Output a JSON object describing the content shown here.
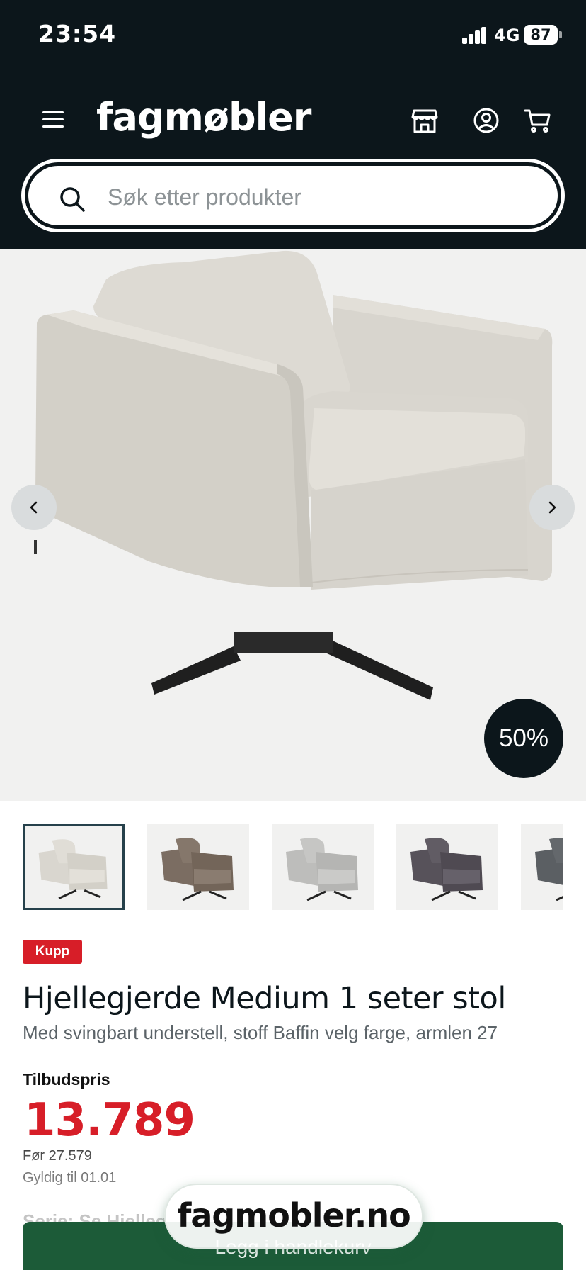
{
  "status_bar": {
    "time": "23:54",
    "network": "4G",
    "battery": "87"
  },
  "header": {
    "logo": "fagmøbler",
    "icons": [
      "menu-icon",
      "store-icon",
      "account-icon",
      "cart-icon"
    ]
  },
  "search": {
    "placeholder": "Søk etter produkter",
    "value": ""
  },
  "gallery": {
    "discount_badge": "50%",
    "thumbnail_colors": [
      "#d9d6cf",
      "#7b6d62",
      "#bdbdbb",
      "#57525a",
      "#5b5f63"
    ],
    "active_thumbnail": 0
  },
  "product": {
    "badge": "Kupp",
    "title": "Hjellegjerde Medium 1 seter stol",
    "subtitle": "Med svingbart understell, stoff Baffin velg farge, armlen 27",
    "price_label": "Tilbudspris",
    "price": "13.789",
    "before_price": "Før 27.579",
    "valid_until": "Gyldig til 01.01",
    "series_partial": "Serie: Se Hjelleg"
  },
  "actions": {
    "add_to_cart": "Legg i handlekurv"
  },
  "browser": {
    "url": "fagmobler.no"
  },
  "colors": {
    "header_bg": "#0c161b",
    "accent_red": "#d71e28",
    "cart_green": "#1c5b38"
  }
}
